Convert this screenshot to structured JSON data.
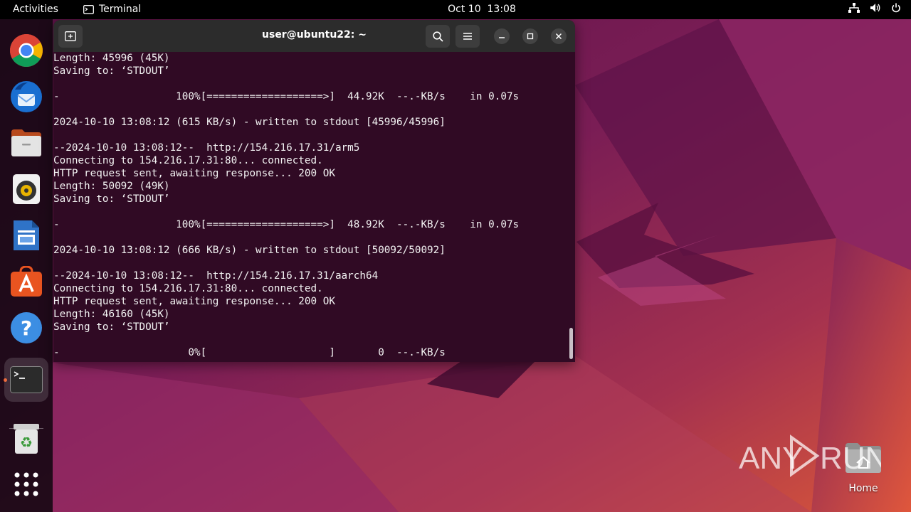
{
  "topbar": {
    "activities": "Activities",
    "app_name": "Terminal",
    "date": "Oct 10",
    "time": "13:08"
  },
  "dock": {
    "items": [
      "Google Chrome",
      "Thunderbird Mail",
      "Files",
      "Rhythmbox",
      "LibreOffice Writer",
      "Ubuntu Software",
      "Help",
      "Terminal",
      "Trash",
      "Show Applications"
    ]
  },
  "terminal": {
    "title": "user@ubuntu22: ~",
    "lines": [
      "Length: 45996 (45K)",
      "Saving to: ‘STDOUT’",
      "",
      "-                   100%[===================>]  44.92K  --.-KB/s    in 0.07s",
      "",
      "2024-10-10 13:08:12 (615 KB/s) - written to stdout [45996/45996]",
      "",
      "--2024-10-10 13:08:12--  http://154.216.17.31/arm5",
      "Connecting to 154.216.17.31:80... connected.",
      "HTTP request sent, awaiting response... 200 OK",
      "Length: 50092 (49K)",
      "Saving to: ‘STDOUT’",
      "",
      "-                   100%[===================>]  48.92K  --.-KB/s    in 0.07s",
      "",
      "2024-10-10 13:08:12 (666 KB/s) - written to stdout [50092/50092]",
      "",
      "--2024-10-10 13:08:12--  http://154.216.17.31/aarch64",
      "Connecting to 154.216.17.31:80... connected.",
      "HTTP request sent, awaiting response... 200 OK",
      "Length: 46160 (45K)",
      "Saving to: ‘STDOUT’",
      "",
      "-                     0%[                    ]       0  --.-KB/s"
    ]
  },
  "desktop": {
    "home_label": "Home",
    "watermark": "ANY RUN"
  },
  "colors": {
    "terminal_bg": "#300a24",
    "accent": "#e95420"
  }
}
